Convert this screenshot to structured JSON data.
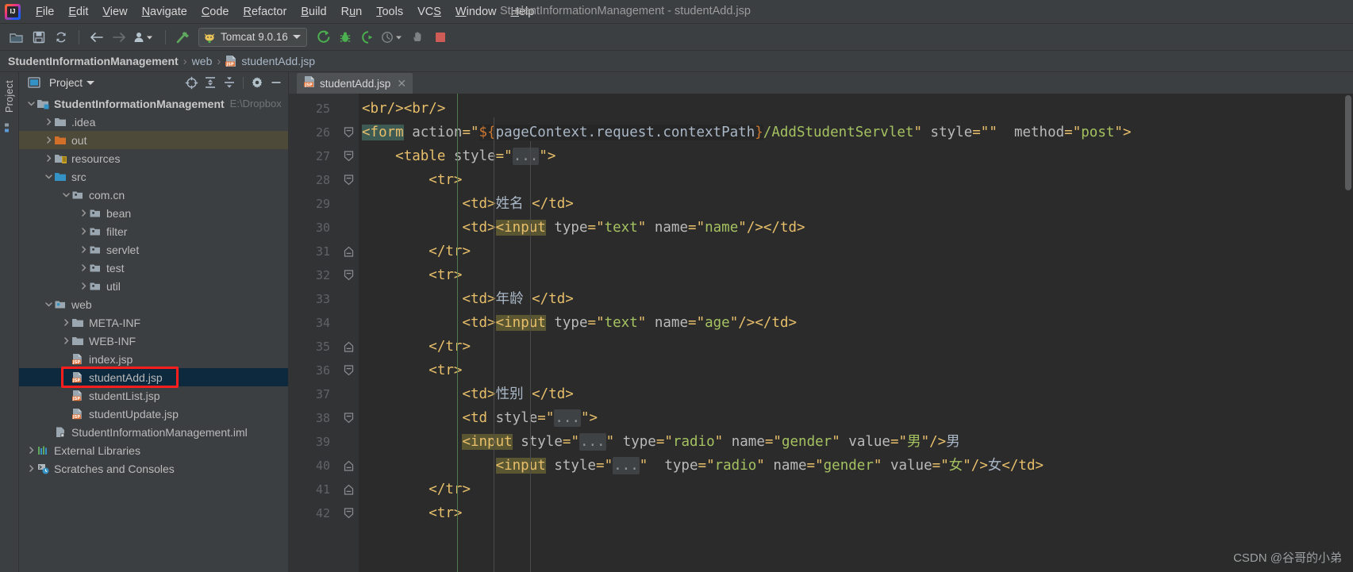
{
  "window": {
    "title": "StudentInformationManagement - studentAdd.jsp",
    "logo_icon": "intellij-idea-logo"
  },
  "menubar": {
    "items": [
      {
        "label": "File",
        "mnemonic": "F"
      },
      {
        "label": "Edit",
        "mnemonic": "E"
      },
      {
        "label": "View",
        "mnemonic": "V"
      },
      {
        "label": "Navigate",
        "mnemonic": "N"
      },
      {
        "label": "Code",
        "mnemonic": "C"
      },
      {
        "label": "Refactor",
        "mnemonic": "R"
      },
      {
        "label": "Build",
        "mnemonic": "B"
      },
      {
        "label": "Run",
        "mnemonic": "u"
      },
      {
        "label": "Tools",
        "mnemonic": "T"
      },
      {
        "label": "VCS",
        "mnemonic": "S"
      },
      {
        "label": "Window",
        "mnemonic": "W"
      },
      {
        "label": "Help",
        "mnemonic": "H"
      }
    ]
  },
  "toolbar": {
    "icons": [
      "open-folder-icon",
      "save-all-icon",
      "sync-refresh-icon",
      "back-arrow-icon",
      "forward-arrow-icon",
      "profile-dropdown-icon",
      "build-hammer-icon"
    ],
    "run_config": {
      "name": "Tomcat 9.0.16",
      "icon": "tomcat-cat-icon",
      "dropdown_icon": "chevron-down-icon"
    },
    "run_icons": [
      "run-green-arrow-icon",
      "debug-bug-icon",
      "run-with-coverage-icon",
      "profile-icon",
      "profile-dropdown-chevron-icon",
      "hand-update-icon",
      "stop-red-square-icon"
    ]
  },
  "breadcrumb": {
    "items": [
      {
        "label": "StudentInformationManagement",
        "bold": true,
        "icon": null
      },
      {
        "label": "web",
        "bold": false,
        "icon": null
      },
      {
        "label": "studentAdd.jsp",
        "bold": false,
        "icon": "jsp-file-icon"
      }
    ],
    "separator": "›"
  },
  "left_strip": {
    "label": "Project",
    "icons": [
      "project-panel-icon",
      "structure-icon"
    ]
  },
  "project_panel": {
    "title": "Project",
    "title_icon": "project-view-icon",
    "dropdown_icon": "chevron-down-icon",
    "toolbar_icons": [
      "locate-target-icon",
      "expand-all-icon",
      "collapse-all-icon",
      "settings-gear-icon",
      "hide-minimize-icon"
    ],
    "tree": [
      {
        "label": "StudentInformationManagement",
        "path": "E:\\Dropbox",
        "depth": 0,
        "arrow": "down",
        "icon": "module-folder-icon",
        "bold": true,
        "state": "normal"
      },
      {
        "label": ".idea",
        "path": "",
        "depth": 1,
        "arrow": "right",
        "icon": "folder-icon",
        "bold": false,
        "state": "normal"
      },
      {
        "label": "out",
        "path": "",
        "depth": 1,
        "arrow": "right",
        "icon": "folder-orange-icon",
        "bold": false,
        "state": "hover"
      },
      {
        "label": "resources",
        "path": "",
        "depth": 1,
        "arrow": "right",
        "icon": "resources-folder-icon",
        "bold": false,
        "state": "normal"
      },
      {
        "label": "src",
        "path": "",
        "depth": 1,
        "arrow": "down",
        "icon": "source-folder-icon",
        "bold": false,
        "state": "normal"
      },
      {
        "label": "com.cn",
        "path": "",
        "depth": 2,
        "arrow": "down",
        "icon": "package-icon",
        "bold": false,
        "state": "normal"
      },
      {
        "label": "bean",
        "path": "",
        "depth": 3,
        "arrow": "right",
        "icon": "package-icon",
        "bold": false,
        "state": "normal"
      },
      {
        "label": "filter",
        "path": "",
        "depth": 3,
        "arrow": "right",
        "icon": "package-icon",
        "bold": false,
        "state": "normal"
      },
      {
        "label": "servlet",
        "path": "",
        "depth": 3,
        "arrow": "right",
        "icon": "package-icon",
        "bold": false,
        "state": "normal"
      },
      {
        "label": "test",
        "path": "",
        "depth": 3,
        "arrow": "right",
        "icon": "package-icon",
        "bold": false,
        "state": "normal"
      },
      {
        "label": "util",
        "path": "",
        "depth": 3,
        "arrow": "right",
        "icon": "package-icon",
        "bold": false,
        "state": "normal"
      },
      {
        "label": "web",
        "path": "",
        "depth": 1,
        "arrow": "down",
        "icon": "web-folder-icon",
        "bold": false,
        "state": "normal"
      },
      {
        "label": "META-INF",
        "path": "",
        "depth": 2,
        "arrow": "right",
        "icon": "folder-icon",
        "bold": false,
        "state": "normal"
      },
      {
        "label": "WEB-INF",
        "path": "",
        "depth": 2,
        "arrow": "right",
        "icon": "folder-icon",
        "bold": false,
        "state": "normal"
      },
      {
        "label": "index.jsp",
        "path": "",
        "depth": 2,
        "arrow": "none",
        "icon": "jsp-file-icon",
        "bold": false,
        "state": "normal"
      },
      {
        "label": "studentAdd.jsp",
        "path": "",
        "depth": 2,
        "arrow": "none",
        "icon": "jsp-file-icon",
        "bold": false,
        "state": "selected"
      },
      {
        "label": "studentList.jsp",
        "path": "",
        "depth": 2,
        "arrow": "none",
        "icon": "jsp-file-icon",
        "bold": false,
        "state": "normal"
      },
      {
        "label": "studentUpdate.jsp",
        "path": "",
        "depth": 2,
        "arrow": "none",
        "icon": "jsp-file-icon",
        "bold": false,
        "state": "normal"
      },
      {
        "label": "StudentInformationManagement.iml",
        "path": "",
        "depth": 1,
        "arrow": "none",
        "icon": "iml-file-icon",
        "bold": false,
        "state": "normal"
      },
      {
        "label": "External Libraries",
        "path": "",
        "depth": 0,
        "arrow": "right",
        "icon": "libraries-icon",
        "bold": false,
        "state": "normal"
      },
      {
        "label": "Scratches and Consoles",
        "path": "",
        "depth": 0,
        "arrow": "right",
        "icon": "scratches-icon",
        "bold": false,
        "state": "normal"
      }
    ]
  },
  "editor": {
    "tab": {
      "name": "studentAdd.jsp",
      "icon": "jsp-file-icon",
      "close_icon": "close-x-icon"
    },
    "first_line_number": 25,
    "lines": [
      {
        "num": 25,
        "fold": null
      },
      {
        "num": 26,
        "fold": "open"
      },
      {
        "num": 27,
        "fold": "open"
      },
      {
        "num": 28,
        "fold": "open"
      },
      {
        "num": 29,
        "fold": null
      },
      {
        "num": 30,
        "fold": null
      },
      {
        "num": 31,
        "fold": "close"
      },
      {
        "num": 32,
        "fold": "open"
      },
      {
        "num": 33,
        "fold": null
      },
      {
        "num": 34,
        "fold": null
      },
      {
        "num": 35,
        "fold": "close"
      },
      {
        "num": 36,
        "fold": "open"
      },
      {
        "num": 37,
        "fold": null
      },
      {
        "num": 38,
        "fold": "open"
      },
      {
        "num": 39,
        "fold": null
      },
      {
        "num": 40,
        "fold": "close"
      },
      {
        "num": 41,
        "fold": "close"
      },
      {
        "num": 42,
        "fold": "open"
      }
    ],
    "code_text": [
      "<br/><br/>",
      "<form action=\"${pageContext.request.contextPath}/AddStudentServlet\" style=\"\"  method=\"post\">",
      "    <table style=\"...\">",
      "        <tr>",
      "            <td>姓名 </td>",
      "            <td><input type=\"text\" name=\"name\"/></td>",
      "        </tr>",
      "        <tr>",
      "            <td>年龄 </td>",
      "            <td><input type=\"text\" name=\"age\"/></td>",
      "        </tr>",
      "        <tr>",
      "            <td>性别 </td>",
      "            <td style=\"...\">",
      "            <input style=\"...\" type=\"radio\" name=\"gender\" value=\"男\"/>男",
      "                <input style=\"...\"  type=\"radio\" name=\"gender\" value=\"女\"/>女</td>",
      "        </tr>",
      "        <tr>"
    ]
  },
  "watermark": "CSDN @谷哥的小弟",
  "colors": {
    "bg_panel": "#3c3f41",
    "bg_editor": "#2b2b2b",
    "gutter": "#313335",
    "tag": "#e8bf6a",
    "attr": "#bababa",
    "value": "#a5c261",
    "text": "#a9b7c6",
    "el": "#cc7832",
    "selection": "#0d293e",
    "hover": "#4e4a39",
    "annotation_red": "#ff1e1e"
  }
}
